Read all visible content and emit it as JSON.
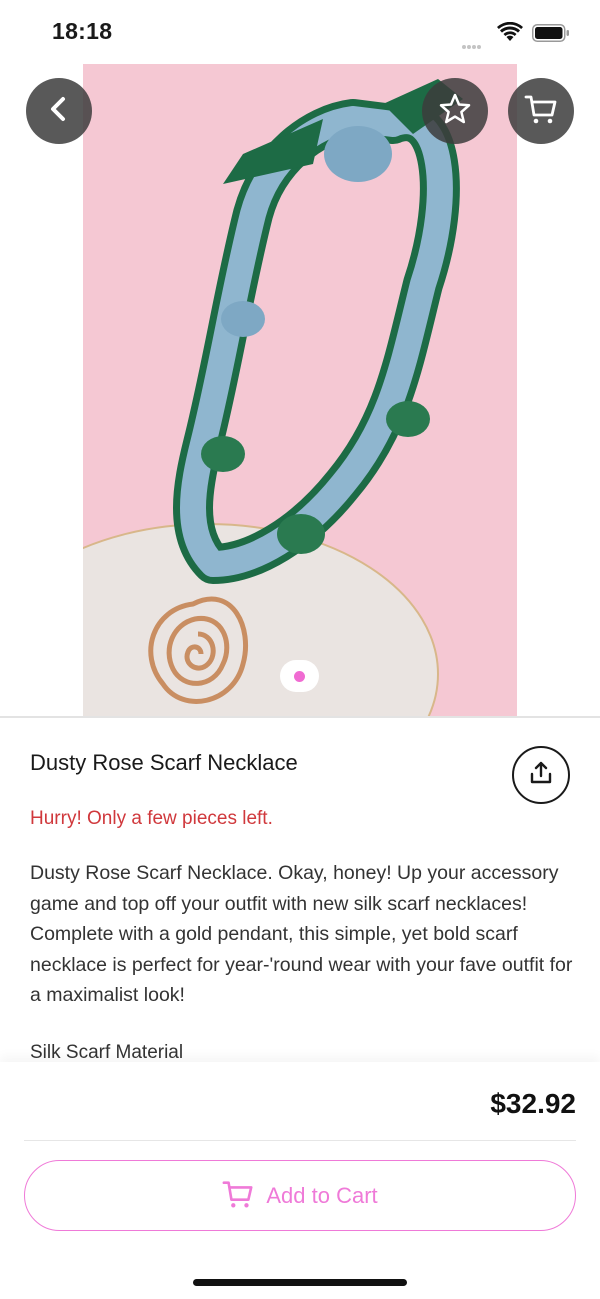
{
  "status_bar": {
    "time": "18:18"
  },
  "product": {
    "title": "Dusty Rose Scarf Necklace",
    "stock_note": "Hurry! Only a few pieces left.",
    "description": "Dusty Rose Scarf Necklace. Okay, honey! Up your accessory game and top off your outfit with new silk scarf necklaces! Complete with a gold pendant, this simple, yet bold scarf necklace is perfect for year-'round wear with your fave outfit for a maximalist look!",
    "material": "Silk Scarf Material",
    "price": "$32.92"
  },
  "actions": {
    "add_to_cart_label": "Add to Cart"
  },
  "icons": {
    "back": "chevron-left-icon",
    "favorite": "star-outline-icon",
    "cart": "cart-icon",
    "share": "share-icon"
  },
  "gallery": {
    "page_count": 1,
    "current_page": 1
  },
  "colors": {
    "accent": "#ef7ad8",
    "stock_warning": "#d0383c",
    "photo_background": "#f5c8d3",
    "round_button": "#3c3c3c"
  }
}
